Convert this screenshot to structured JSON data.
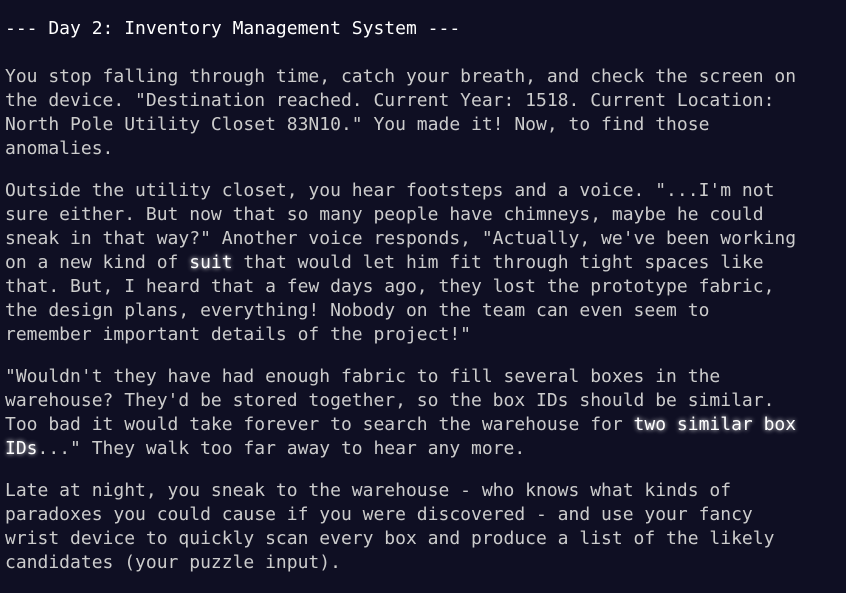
{
  "title": "--- Day 2: Inventory Management System ---",
  "p1": "You stop falling through time, catch your breath, and check the screen on\nthe device. \"Destination reached. Current Year: 1518. Current Location:\nNorth Pole Utility Closet 83N10.\" You made it! Now, to find those\nanomalies.",
  "p2_a": "Outside the utility closet, you hear footsteps and a voice. \"...I'm not\nsure either. But now that so many people have chimneys, maybe he could\nsneak in that way?\" Another voice responds, \"Actually, we've been working\non a new kind of ",
  "p2_em": "suit",
  "p2_b": " that would let him fit through tight spaces like\nthat. But, I heard that a few days ago, they lost the prototype fabric,\nthe design plans, everything! Nobody on the team can even seem to\nremember important details of the project!\"",
  "p3_a": "\"Wouldn't they have had enough fabric to fill several boxes in the\nwarehouse? They'd be stored together, so the box IDs should be similar.\nToo bad it would take forever to search the warehouse for ",
  "p3_em": "two similar box\nIDs",
  "p3_b": "...\" They walk too far away to hear any more.",
  "p4": "Late at night, you sneak to the warehouse - who knows what kinds of\nparadoxes you could cause if you were discovered - and use your fancy\nwrist device to quickly scan every box and produce a list of the likely\ncandidates (your puzzle input)."
}
